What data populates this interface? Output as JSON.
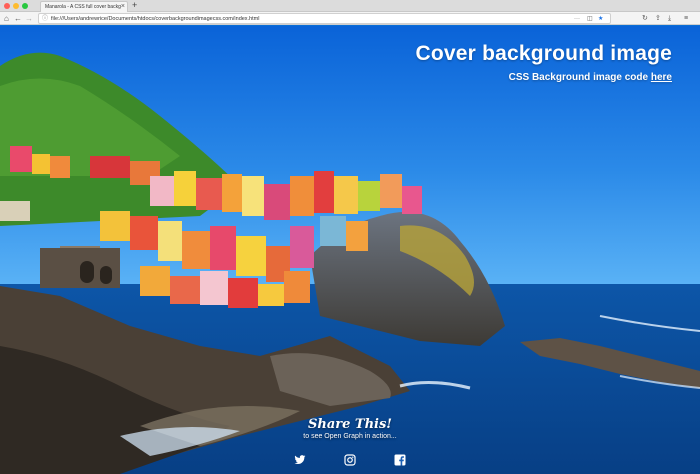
{
  "browser": {
    "tab_title": "Manarola - A CSS full cover backg",
    "tab_close": "×",
    "new_tab": "+",
    "url": "file:///Users/andrewrice/Documents/htdocs/coverbackgroundimagecss.com/index.html",
    "nav": {
      "back": "←",
      "forward": "→",
      "reload": "↻",
      "home": "⌂"
    },
    "url_actions": {
      "more": "···",
      "pocket": "◫",
      "star": "★"
    },
    "tools": {
      "sync": "⟳",
      "library": "⇪",
      "download": "⤓",
      "menu": "≡"
    }
  },
  "hero": {
    "title": "Cover background image",
    "subtitle_prefix": "CSS Background image code ",
    "subtitle_link": "here"
  },
  "share": {
    "title": "Share This!",
    "subtitle": "to see Open Graph in action...",
    "icons": [
      "twitter-icon",
      "instagram-icon",
      "facebook-icon"
    ]
  },
  "colors": {
    "sky_top": "#0a63d8",
    "sky_bottom": "#46a4f2",
    "sea": "#0c4fa0",
    "hill_green": "#3d8a2a"
  }
}
